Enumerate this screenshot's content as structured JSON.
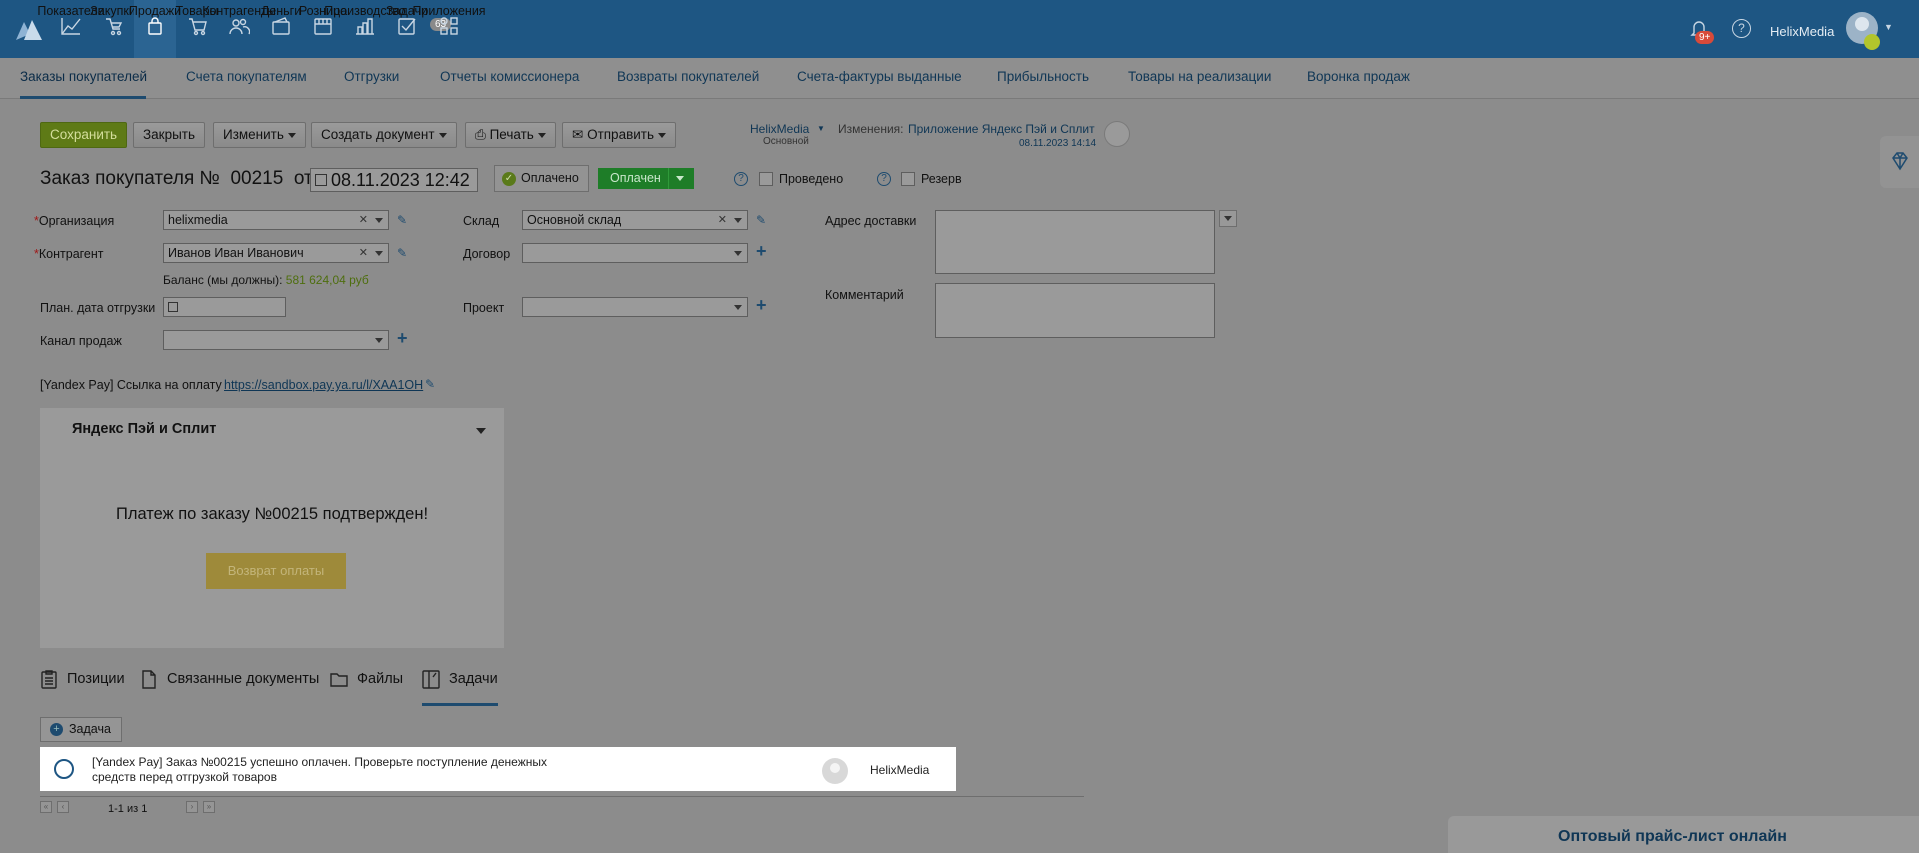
{
  "topnav": {
    "items": [
      {
        "label": "Показатели",
        "icon": "chart-line-icon"
      },
      {
        "label": "Закупки",
        "icon": "cart-hand-icon"
      },
      {
        "label": "Продажи",
        "icon": "shopping-bag-icon",
        "active": true
      },
      {
        "label": "Товары",
        "icon": "cart-icon"
      },
      {
        "label": "Контрагенты",
        "icon": "people-icon"
      },
      {
        "label": "Деньги",
        "icon": "wallet-icon"
      },
      {
        "label": "Розница",
        "icon": "cash-register-icon"
      },
      {
        "label": "Производство",
        "icon": "bar-chart-icon"
      },
      {
        "label": "Задачи",
        "icon": "checkbox-icon",
        "badge": "63"
      },
      {
        "label": "Приложения",
        "icon": "apps-icon"
      }
    ],
    "notifications_badge": "9+",
    "help": "?",
    "username": "HelixMedia"
  },
  "subnav": {
    "items": [
      "Заказы покупателей",
      "Счета покупателям",
      "Отгрузки",
      "Отчеты комиссионера",
      "Возвраты покупателей",
      "Счета-фактуры выданные",
      "Прибыльность",
      "Товары на реализации",
      "Воронка продаж"
    ]
  },
  "toolbar": {
    "save": "Сохранить",
    "close": "Закрыть",
    "edit": "Изменить",
    "create_doc": "Создать документ",
    "print": "Печать",
    "send": "Отправить"
  },
  "meta": {
    "author": "HelixMedia",
    "author_role": "Основной",
    "changes_label": "Изменения:",
    "changes_by": "Приложение Яндекс Пэй и Сплит",
    "changes_date": "08.11.2023 14:14"
  },
  "header": {
    "title_prefix": "Заказ покупателя №",
    "number": "00215",
    "from": "от",
    "date": "08.11.2023 12:42",
    "paid_label": "Оплачено",
    "status": "Оплачен",
    "posted_label": "Проведено",
    "reserve_label": "Резерв"
  },
  "form": {
    "organization_label": "Организация",
    "organization_value": "helixmedia",
    "counterparty_label": "Контрагент",
    "counterparty_value": "Иванов Иван Иванович",
    "balance_label": "Баланс (мы должны):",
    "balance_value": "581 624,04 руб",
    "ship_date_label": "План. дата отгрузки",
    "channel_label": "Канал продаж",
    "warehouse_label": "Склад",
    "warehouse_value": "Основной склад",
    "contract_label": "Договор",
    "project_label": "Проект",
    "address_label": "Адрес доставки",
    "comment_label": "Комментарий"
  },
  "payment": {
    "link_label": "[Yandex Pay] Ссылка на оплату",
    "link_value": "https://sandbox.pay.ya.ru/l/XAA1OH"
  },
  "panel": {
    "title": "Яндекс Пэй и Сплит",
    "message": "Платеж по заказу №00215 подтвержден!",
    "refund_button": "Возврат оплаты"
  },
  "tabs": [
    {
      "label": "Позиции",
      "icon": "clipboard-icon"
    },
    {
      "label": "Связанные документы",
      "icon": "document-icon"
    },
    {
      "label": "Файлы",
      "icon": "folder-icon"
    },
    {
      "label": "Задачи",
      "icon": "tasks-icon",
      "active": true
    }
  ],
  "tasks": {
    "add_button": "Задача",
    "rows": [
      {
        "text": "[Yandex Pay] Заказ №00215 успешно оплачен. Проверьте поступление денежных средств перед отгрузкой товаров",
        "user": "HelixMedia"
      }
    ],
    "pagination": "1-1 из 1"
  },
  "promo": {
    "text": "Оптовый прайс-лист онлайн"
  }
}
